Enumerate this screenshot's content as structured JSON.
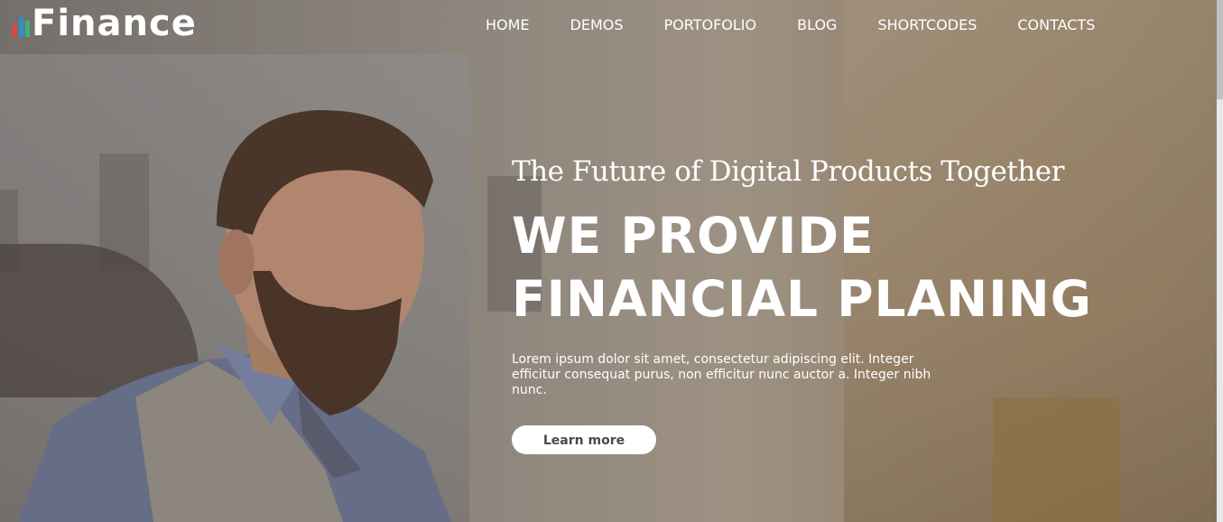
{
  "brand": {
    "name": "Finance",
    "bar_colors": [
      "#e5443c",
      "#2f8fd1",
      "#36b37e"
    ]
  },
  "nav": {
    "items": [
      {
        "label": "HOME"
      },
      {
        "label": "DEMOS"
      },
      {
        "label": "PORTOFOLIO"
      },
      {
        "label": "BLOG"
      },
      {
        "label": "SHORTCODES"
      },
      {
        "label": "CONTACTS"
      }
    ]
  },
  "hero": {
    "subtitle": "The Future of Digital Products Together",
    "title_line1": "WE PROVIDE",
    "title_line2": "FINANCIAL PLANING",
    "description": "Lorem ipsum dolor sit amet, consectetur adipiscing elit. Integer efficitur consequat purus, non efficitur nunc auctor a. Integer nibh nunc.",
    "cta_label": "Learn more"
  },
  "colors": {
    "text": "#ffffff",
    "button_bg": "#ffffff",
    "button_text": "#4a4a4a"
  }
}
